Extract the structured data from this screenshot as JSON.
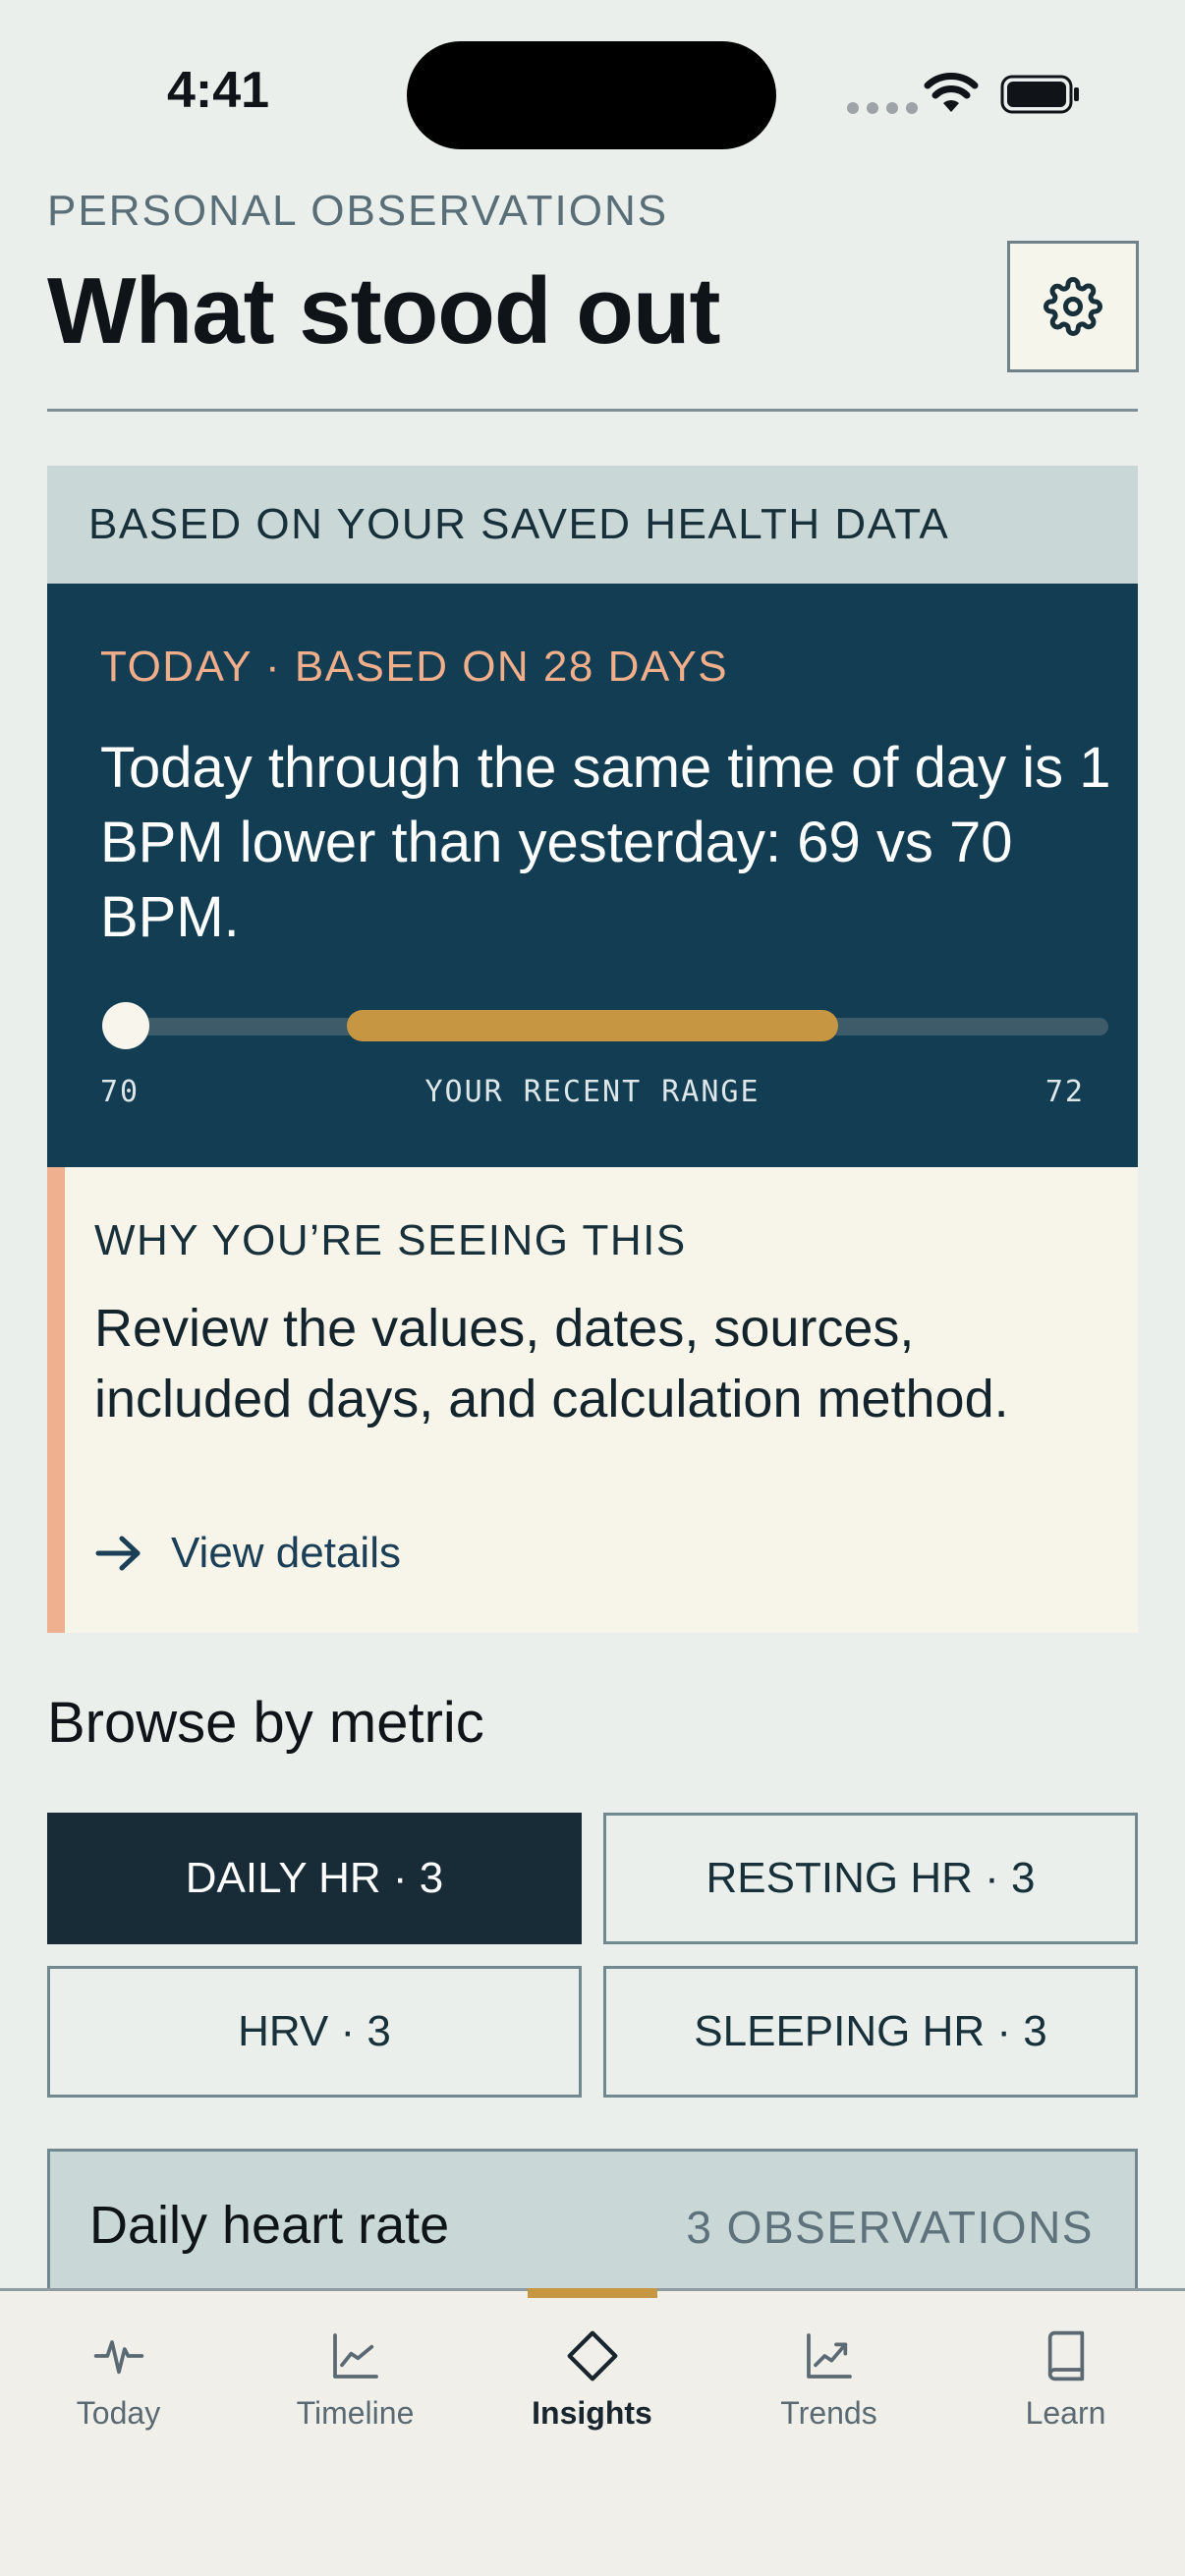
{
  "status_bar": {
    "time": "4:41"
  },
  "header": {
    "eyebrow": "PERSONAL OBSERVATIONS",
    "title": "What stood out"
  },
  "observation": {
    "source_label": "BASED ON YOUR SAVED HEALTH DATA",
    "meta": "TODAY · BASED ON 28 DAYS",
    "statement": "Today through the same time of day is 1 BPM lower than yesterday: 69 vs 70 BPM.",
    "range": {
      "min_label": "70",
      "mid_label": "YOUR RECENT RANGE",
      "max_label": "72"
    },
    "why": {
      "title": "WHY YOU’RE SEEING THIS",
      "text": "Review the values, dates, sources, included days, and calculation method.",
      "link": "View details"
    }
  },
  "browse": {
    "title": "Browse by metric",
    "chips": [
      {
        "label": "DAILY HR · 3",
        "active": true
      },
      {
        "label": "RESTING HR · 3",
        "active": false
      },
      {
        "label": "HRV · 3",
        "active": false
      },
      {
        "label": "SLEEPING HR · 3",
        "active": false
      }
    ]
  },
  "metric_section": {
    "title": "Daily heart rate",
    "count": "3 OBSERVATIONS"
  },
  "tab_bar": {
    "tabs": [
      {
        "label": "Today",
        "icon": "pulse-icon"
      },
      {
        "label": "Timeline",
        "icon": "line-chart-icon"
      },
      {
        "label": "Insights",
        "icon": "diamond-icon",
        "active": true
      },
      {
        "label": "Trends",
        "icon": "trend-up-icon"
      },
      {
        "label": "Learn",
        "icon": "book-icon"
      }
    ]
  },
  "colors": {
    "background": "#EAEFEB",
    "card_dark": "#133D53",
    "accent_orange": "#F0AE8B",
    "accent_gold": "#C69642",
    "chip_active": "#182C37"
  }
}
